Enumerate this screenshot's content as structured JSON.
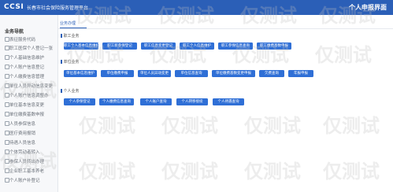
{
  "header": {
    "logo": "CCSI",
    "title": "长春市社会保险服务管理平台",
    "user_link": "个人申报界面"
  },
  "sidebar": {
    "header": "业务导航",
    "items": [
      {
        "label": "表征服务代码"
      },
      {
        "label": "职工医保个人登记一张"
      },
      {
        "label": "个人基础信息维护"
      },
      {
        "label": "个人账户信息登记"
      },
      {
        "label": "个人缴费信息管理"
      },
      {
        "label": "单位人员异动信息变更"
      },
      {
        "label": "个人账户信息调整办"
      },
      {
        "label": "单位基本信息变更"
      },
      {
        "label": "单位缴费基数申报"
      },
      {
        "label": "人员参保信息"
      },
      {
        "label": "医疗费用报销"
      },
      {
        "label": "待遇人员信息"
      },
      {
        "label": "个体劳动者转入"
      },
      {
        "label": "参保人员转出办理"
      },
      {
        "label": "企业职工基本养老"
      },
      {
        "label": "个人账户补登记"
      }
    ]
  },
  "main": {
    "tab_label": "业务办理",
    "sections": [
      {
        "title": "职工业务",
        "buttons": [
          "职工个人基本信息维护",
          "职工新参保登记",
          "职工信息变更登记",
          "职工个人信息维护",
          "职工参保信息查询",
          "职工缴费基数申报"
        ]
      },
      {
        "title": "单位业务",
        "buttons": [
          "单位基本信息维护",
          "单位缴费申报",
          "单位人员异动变更",
          "单位信息查询",
          "单位缴费基数变更申报",
          "欠费查询",
          "年报申报"
        ]
      },
      {
        "title": "个人业务",
        "buttons": [
          "个人参保登记",
          "个人缴费信息查询",
          "个人账户查询",
          "个人转移接续",
          "个人待遇查询"
        ]
      }
    ]
  },
  "watermark_text": "仅测试",
  "colors": {
    "header_bg": "#2b5fb7",
    "button_bg": "#2f6fd6",
    "sidebar_bg": "#f7f8fa"
  }
}
